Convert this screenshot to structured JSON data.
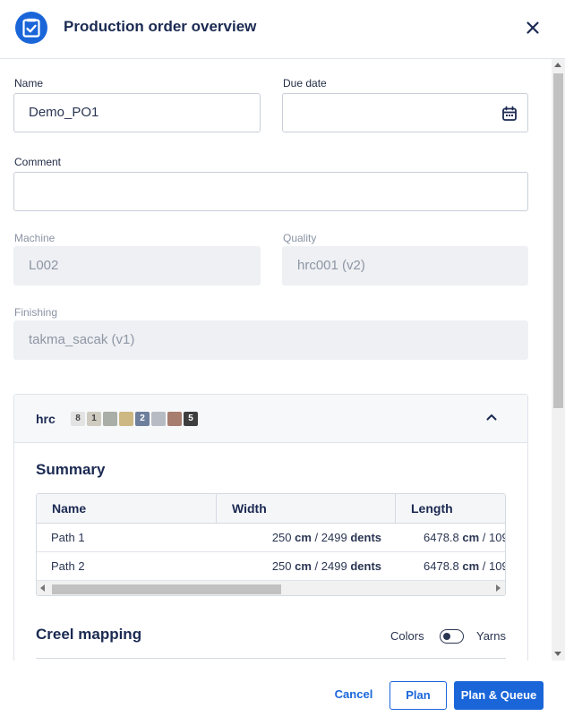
{
  "header": {
    "title": "Production order overview"
  },
  "form": {
    "name_label": "Name",
    "name_value": "Demo_PO1",
    "due_label": "Due date",
    "due_value": "",
    "comment_label": "Comment",
    "comment_value": "",
    "machine_label": "Machine",
    "machine_value": "L002",
    "quality_label": "Quality",
    "quality_value": "hrc001 (v2)",
    "finishing_label": "Finishing",
    "finishing_value": "takma_sacak (v1)"
  },
  "section": {
    "title": "hrc",
    "swatches": [
      {
        "label": "8",
        "color": "#e3e3e3",
        "text_color": "#444444"
      },
      {
        "label": "1",
        "color": "#cfcbc0",
        "text_color": "#444444"
      },
      {
        "label": "",
        "color": "#a9aea6"
      },
      {
        "label": "",
        "color": "#cdb884"
      },
      {
        "label": "2",
        "color": "#6e7f9c",
        "text_color": "#ffffff"
      },
      {
        "label": "",
        "color": "#b7bcc4"
      },
      {
        "label": "",
        "color": "#a77d70"
      },
      {
        "label": "5",
        "color": "#3e3e3e",
        "text_color": "#ffffff"
      }
    ]
  },
  "summary": {
    "title": "Summary",
    "columns": [
      "Name",
      "Width",
      "Length"
    ],
    "rows": [
      {
        "name": "Path 1",
        "width_num": "250",
        "width_unit": "cm",
        "width_sep": " / ",
        "width_dents": "2499",
        "width_dunit": "dents",
        "length_num": "6478.8",
        "length_unit": "cm",
        "length_rest": " / 109"
      },
      {
        "name": "Path 2",
        "width_num": "250",
        "width_unit": "cm",
        "width_sep": " / ",
        "width_dents": "2499",
        "width_dunit": "dents",
        "length_num": "6478.8",
        "length_unit": "cm",
        "length_rest": " / 109"
      }
    ]
  },
  "creel": {
    "title": "Creel mapping",
    "colors_label": "Colors",
    "yarns_label": "Yarns"
  },
  "footer": {
    "cancel": "Cancel",
    "plan": "Plan",
    "plan_queue": "Plan & Queue"
  },
  "colors": {
    "accent": "#1a66d9",
    "title": "#1b2a52"
  }
}
